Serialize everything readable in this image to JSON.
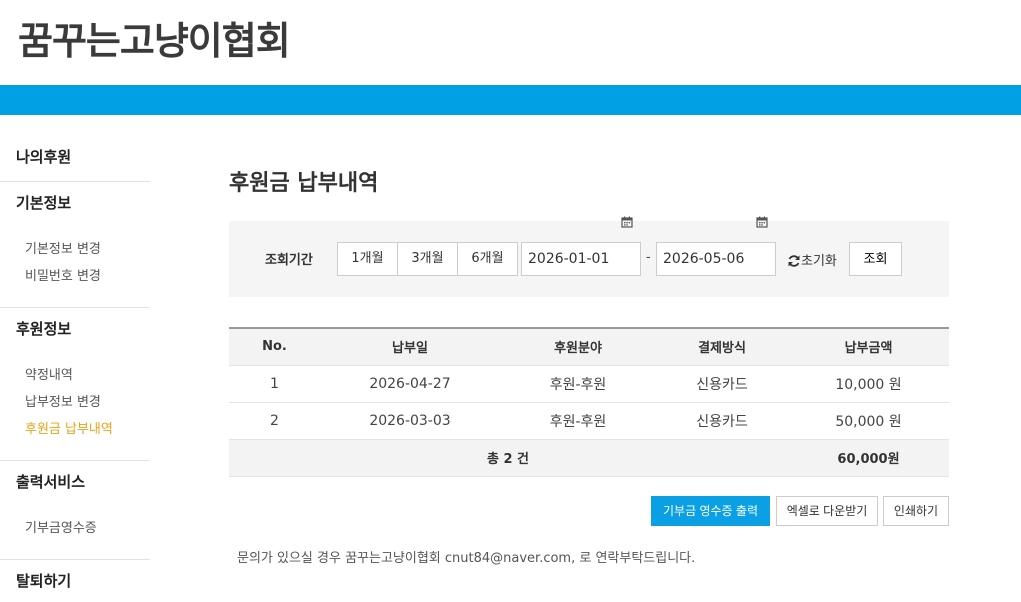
{
  "header": {
    "site_title": "꿈꾸는고냥이협회"
  },
  "sidebar": {
    "sections": [
      {
        "heading": "나의후원",
        "items": []
      },
      {
        "heading": "기본정보",
        "items": [
          "기본정보 변경",
          "비밀번호 변경"
        ]
      },
      {
        "heading": "후원정보",
        "items": [
          "약정내역",
          "납부정보 변경",
          "후원금 납부내역"
        ],
        "active_index": 2
      },
      {
        "heading": "출력서비스",
        "items": [
          "기부금영수증"
        ]
      },
      {
        "heading": "탈퇴하기",
        "items": []
      }
    ]
  },
  "main": {
    "title": "후원금 납부내역",
    "search": {
      "label": "조회기간",
      "periods": [
        "1개월",
        "3개월",
        "6개월"
      ],
      "date_from": "2026-01-01",
      "date_to": "2026-05-06",
      "separator": "-",
      "reset_label": "초기화",
      "query_label": "조회",
      "calendar_icon": "calendar-icon",
      "reset_icon": "refresh-icon"
    },
    "table": {
      "headers": [
        "No.",
        "납부일",
        "후원분야",
        "결제방식",
        "납부금액"
      ],
      "rows": [
        [
          "1",
          "2026-04-27",
          "후원-후원",
          "신용카드",
          "10,000 원"
        ],
        [
          "2",
          "2026-03-03",
          "후원-후원",
          "신용카드",
          "50,000 원"
        ]
      ],
      "total_label": "총 2 건",
      "total_amount": "60,000원"
    },
    "actions": {
      "receipt_print": "기부금 영수증 출력",
      "excel_download": "엑셀로 다운받기",
      "print": "인쇄하기"
    },
    "notice": "문의가 있으실 경우 꿈꾸는고냥이협회 cnut84@naver.com, 로 연락부탁드립니다."
  },
  "colors": {
    "accent_blue": "#00a0e4",
    "active_link": "#e8a317"
  }
}
